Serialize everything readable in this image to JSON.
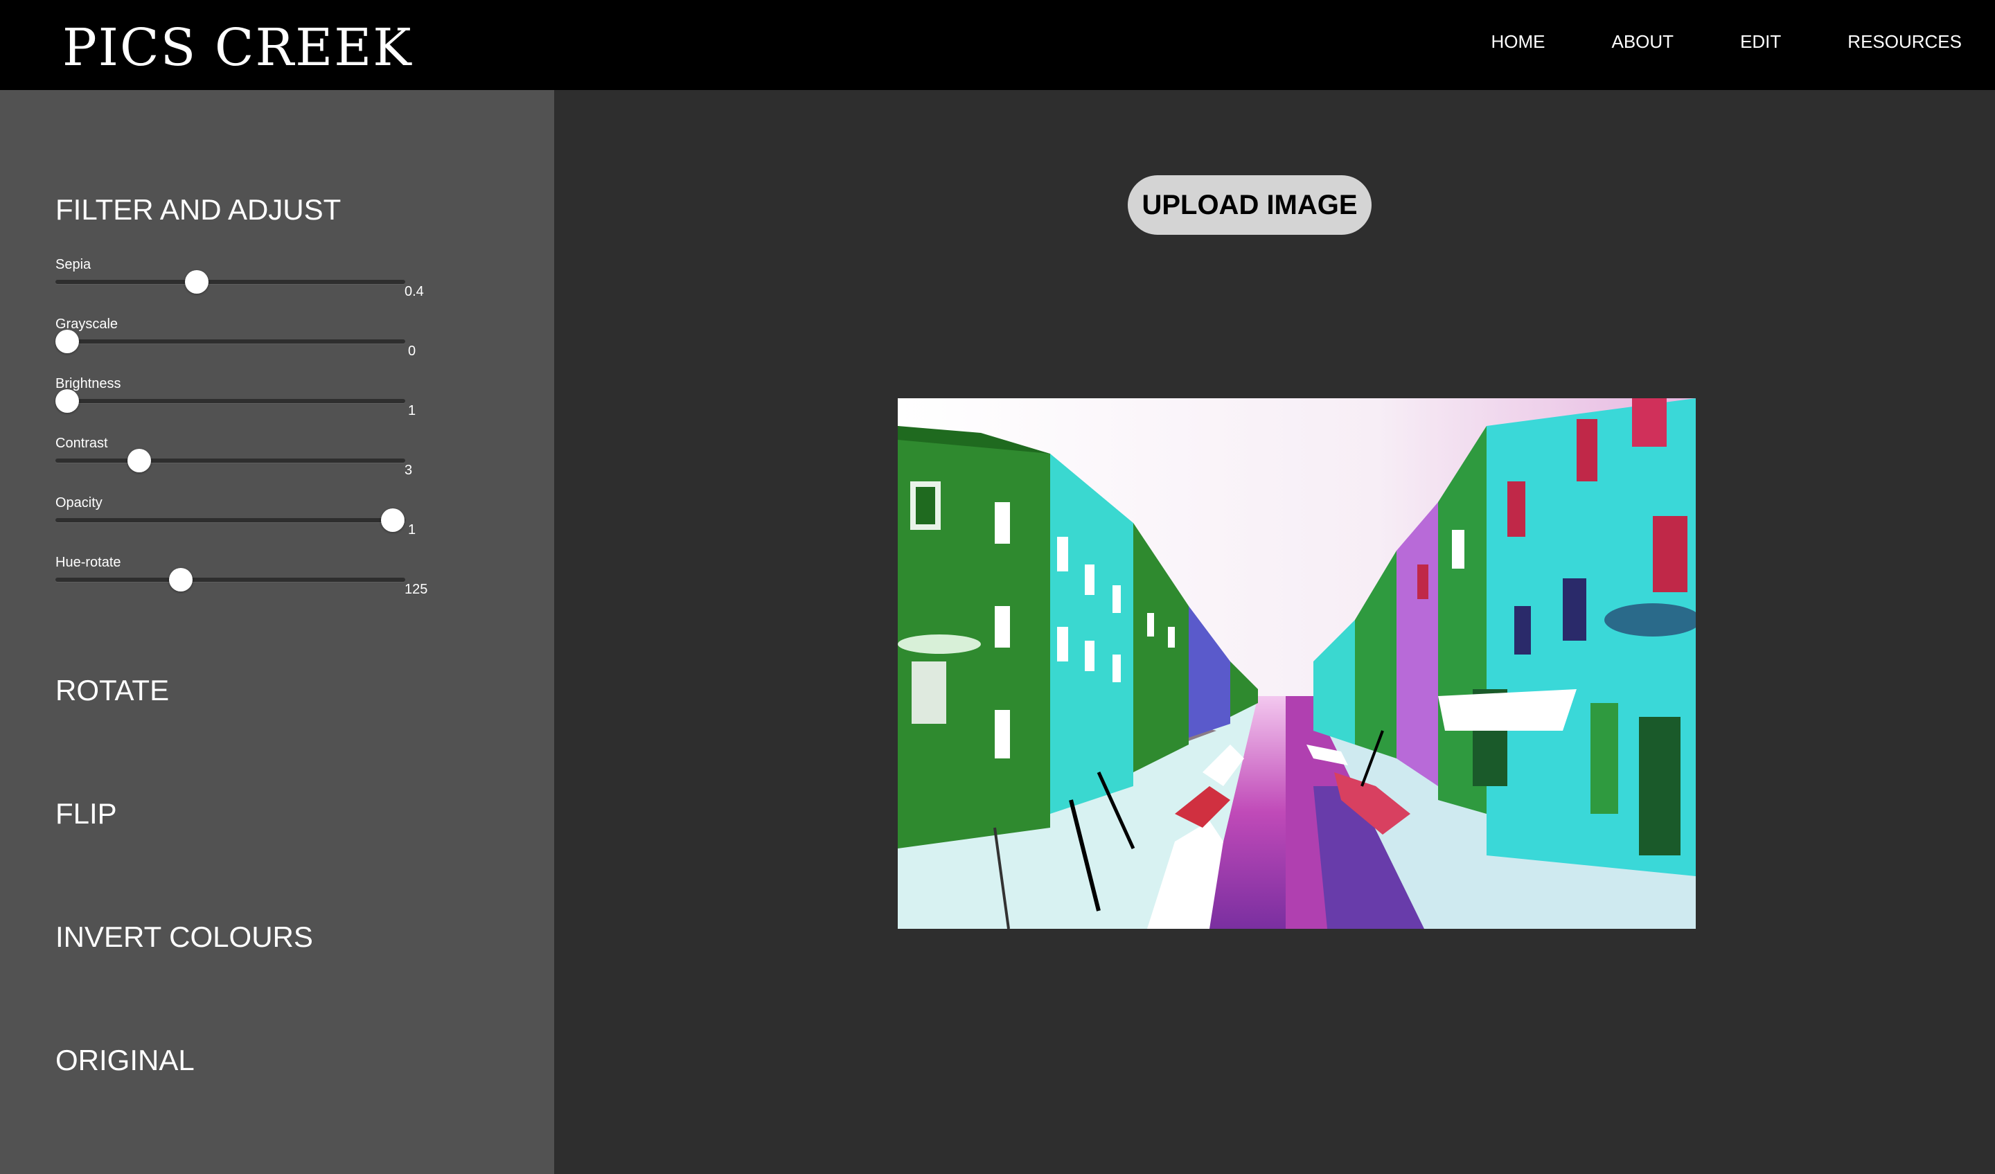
{
  "header": {
    "logo": "PICS CREEK",
    "nav": [
      "HOME",
      "ABOUT",
      "EDIT",
      "RESOURCES"
    ]
  },
  "sidebar": {
    "filter_title": "FILTER AND ADJUST",
    "sliders": [
      {
        "label": "Sepia",
        "value": "0.4"
      },
      {
        "label": "Grayscale",
        "value": "0"
      },
      {
        "label": "Brightness",
        "value": "1"
      },
      {
        "label": "Contrast",
        "value": "3"
      },
      {
        "label": "Opacity",
        "value": "1"
      },
      {
        "label": "Hue-rotate",
        "value": "125"
      }
    ],
    "rotate": "ROTATE",
    "flip": "FLIP",
    "invert": "INVERT COLOURS",
    "original": "ORIGINAL"
  },
  "main": {
    "upload_label": "UPLOAD IMAGE"
  },
  "colors": {
    "header_bg": "#000000",
    "sidebar_bg": "#525252",
    "main_bg": "#2e2e2e",
    "button_bg": "#d4d4d4"
  }
}
